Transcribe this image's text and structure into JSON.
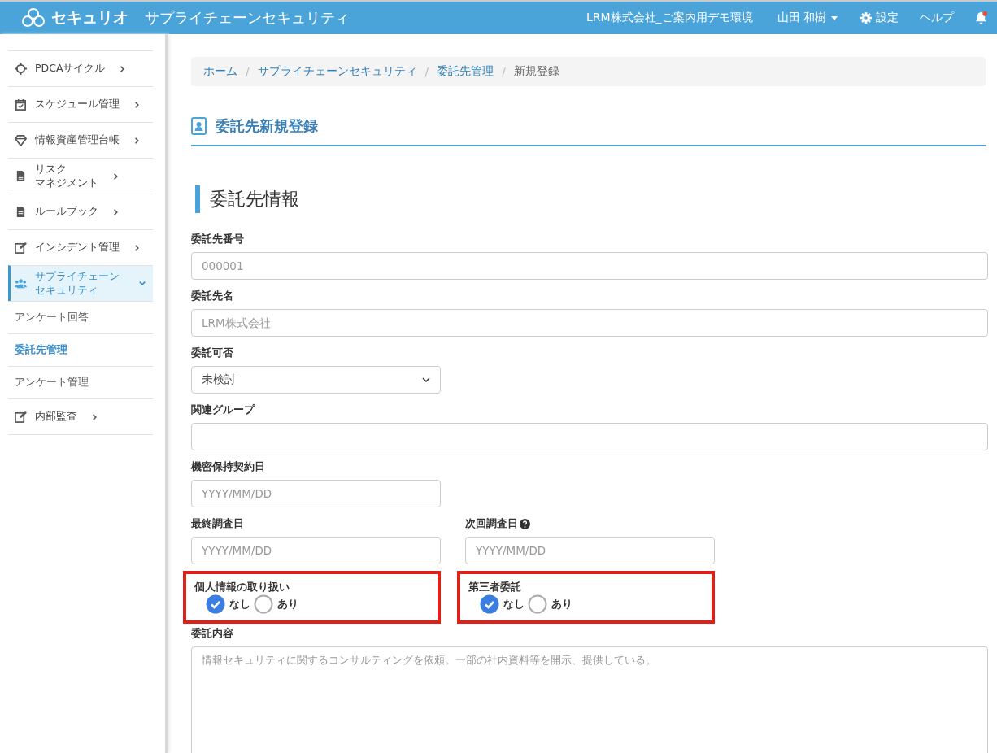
{
  "header": {
    "logo": "セキュリオ",
    "app_title": "サプライチェーンセキュリティ",
    "organization": "LRM株式会社_ご案内用デモ環境",
    "user": "山田 和樹",
    "settings": "設定",
    "help": "ヘルプ",
    "notification_unread": true
  },
  "sidebar": {
    "items": [
      {
        "label": "PDCAサイクル",
        "selected": false,
        "expanded": false
      },
      {
        "label": "スケジュール管理",
        "selected": false,
        "expanded": false
      },
      {
        "label": "情報資産管理台帳",
        "selected": false,
        "expanded": false
      },
      {
        "label_lines": [
          "リスク",
          "マネジメント"
        ],
        "selected": false,
        "expanded": false
      },
      {
        "label": "ルールブック",
        "selected": false,
        "expanded": false
      },
      {
        "label": "インシデント管理",
        "selected": false,
        "expanded": false
      },
      {
        "label_lines": [
          "サプライチェーン",
          "セキュリティ"
        ],
        "selected": true,
        "expanded": true,
        "children": [
          {
            "label": "アンケート回答",
            "selected": false
          },
          {
            "label": "委託先管理",
            "selected": true
          },
          {
            "label": "アンケート管理",
            "selected": false
          }
        ]
      },
      {
        "label": "内部監査",
        "selected": false,
        "expanded": false
      }
    ]
  },
  "breadcrumb": [
    {
      "label": "ホーム",
      "link": true
    },
    {
      "separator": "/",
      "label": "サプライチェーンセキュリティ",
      "link": true
    },
    {
      "separator": "/",
      "label": "委託先管理",
      "link": true
    },
    {
      "separator": "/",
      "label": "新規登録",
      "link": false
    }
  ],
  "page_title": "委託先新規登録",
  "section_title": "委託先情報",
  "form_rows": [
    [
      {
        "kind": "text",
        "label": "委託先番号",
        "placeholder": "000001"
      }
    ],
    [
      {
        "kind": "text",
        "label": "委託先名",
        "placeholder": "LRM株式会社"
      }
    ],
    [
      {
        "kind": "select",
        "label": "委託可否",
        "value": "未検討"
      }
    ],
    [
      {
        "kind": "text",
        "label": "関連グループ"
      }
    ],
    [
      {
        "kind": "date",
        "label": "機密保持契約日",
        "placeholder": "YYYY/MM/DD"
      }
    ],
    [
      {
        "kind": "date",
        "label": "最終調査日",
        "placeholder": "YYYY/MM/DD"
      },
      {
        "kind": "date",
        "label": "次回調査日",
        "placeholder": "YYYY/MM/DD",
        "help": true
      }
    ],
    [
      {
        "kind": "radio",
        "label": "個人情報の取り扱い",
        "highlighted": true,
        "options": [
          {
            "label": "なし",
            "selected": true
          },
          {
            "label": "あり",
            "selected": false
          }
        ]
      },
      {
        "kind": "radio",
        "label": "第三者委託",
        "highlighted": true,
        "options": [
          {
            "label": "なし",
            "selected": true
          },
          {
            "label": "あり",
            "selected": false
          }
        ]
      }
    ],
    [
      {
        "kind": "textarea",
        "label": "委託内容",
        "placeholder": "情報セキュリティに関するコンサルティングを依頼。一部の社内資料等を開示、提供している。"
      }
    ]
  ]
}
